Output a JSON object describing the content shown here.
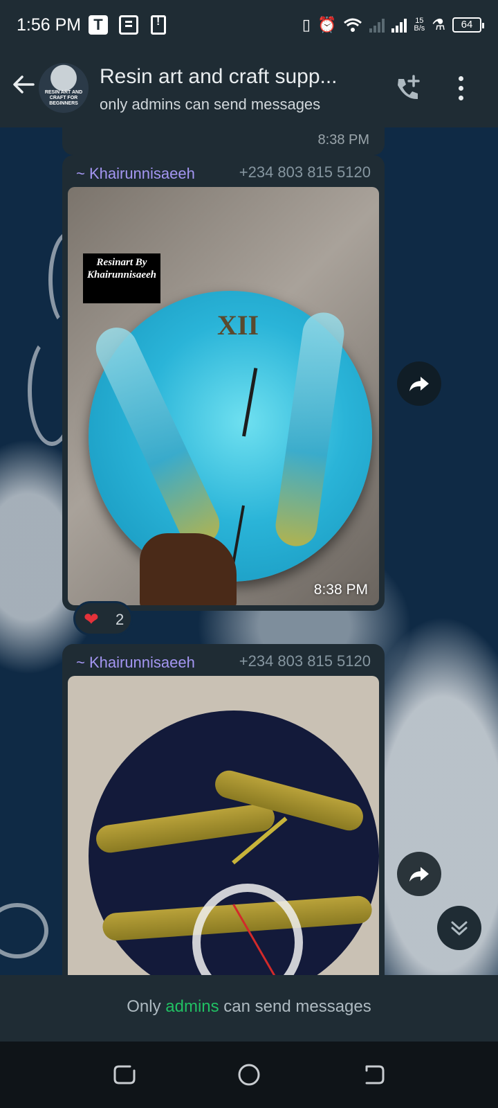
{
  "status_bar": {
    "time": "1:56 PM",
    "app_icons": [
      "t-app-icon",
      "document-icon",
      "phone-alert-icon"
    ],
    "net_rate_value": "15",
    "net_rate_unit": "B/s",
    "battery": "64"
  },
  "header": {
    "title": "Resin art and craft supp...",
    "subtitle": "only admins can send messages",
    "avatar_text": "RESIN ART AND CRAFT FOR BEGINNERS"
  },
  "messages": [
    {
      "time": "8:38 PM"
    },
    {
      "sender": "~ Khairunnisaeeh",
      "phone": "+234 803 815 5120",
      "media_time": "8:38 PM",
      "watermark": "Resinart By Khairunnisaeeh",
      "clock_numeral": "XII",
      "reaction": {
        "emoji": "❤",
        "count": "2"
      }
    },
    {
      "sender": "~ Khairunnisaeeh",
      "phone": "+234 803 815 5120"
    }
  ],
  "footer": {
    "prefix": "Only",
    "link": "admins",
    "suffix": "can send messages"
  },
  "colors": {
    "header_bg": "#1f2c34",
    "sender_name": "#a496f2",
    "link_green": "#21c063"
  }
}
